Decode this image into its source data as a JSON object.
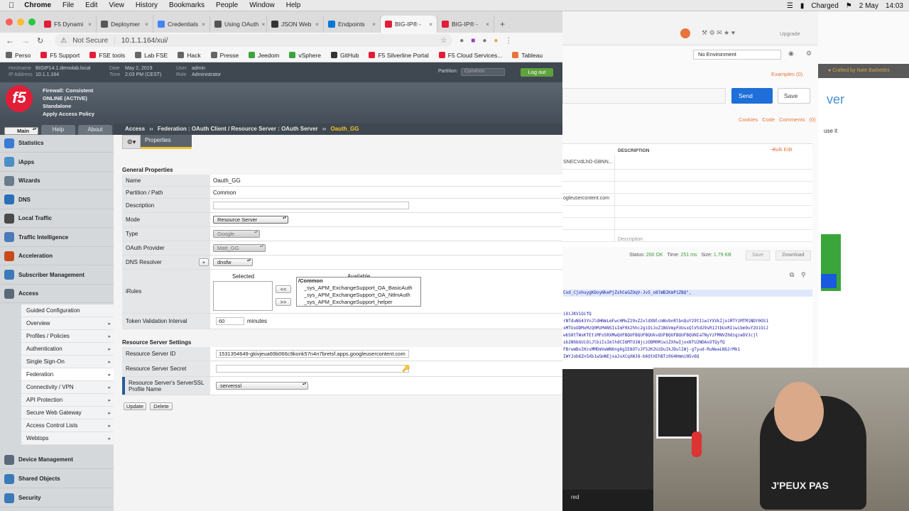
{
  "os_menubar": {
    "app": "Chrome",
    "menus": [
      "File",
      "Edit",
      "View",
      "History",
      "Bookmarks",
      "People",
      "Window",
      "Help"
    ],
    "battery": "Charged",
    "date": "2 May",
    "time": "14:03"
  },
  "browser": {
    "tabs": [
      {
        "label": "F5 Dynami",
        "color": "#e21d38"
      },
      {
        "label": "Deploymer",
        "color": "#555555"
      },
      {
        "label": "Credentials",
        "color": "#4285f4"
      },
      {
        "label": "Using OAuth",
        "color": "#555555"
      },
      {
        "label": "JSON Web",
        "color": "#333333"
      },
      {
        "label": "Endpoints",
        "color": "#0078d4"
      },
      {
        "label": "BIG-IP® -",
        "color": "#e21d38",
        "active": true
      },
      {
        "label": "BIG-IP® -",
        "color": "#e21d38"
      }
    ],
    "security": "Not Secure",
    "url": "10.1.1.164/xui/",
    "bookmarks": [
      "Perso",
      "F5 Support",
      "FSE tools",
      "Lab FSE",
      "Hack",
      "Presse",
      "Jeedom",
      "vSphere",
      "GitHub",
      "F5 Silverline Portal",
      "F5 Cloud Services...",
      "Tableau"
    ]
  },
  "f5": {
    "header": {
      "hostname_label": "Hostname",
      "hostname": "BIGIP14.1.demolab.local",
      "ip_label": "IP Address",
      "ip": "10.1.1.164",
      "date_label": "Date",
      "date": "May 2, 2019",
      "time_label": "Time",
      "time": "2:03 PM (CEST)",
      "user_label": "User",
      "user": "admin",
      "role_label": "Role",
      "role": "Administrator",
      "partition_label": "Partition:",
      "partition": "Common",
      "logout": "Log out"
    },
    "logo": "f5",
    "status_lines": [
      "Firewall: Consistent",
      "ONLINE (ACTIVE)",
      "Standalone",
      "Apply Access Policy"
    ],
    "nav_tabs": [
      "Main",
      "Help",
      "About"
    ],
    "breadcrumb": {
      "root": "Access",
      "sep": "››",
      "mid": "Federation : OAuth Client / Resource Server : OAuth Server",
      "sep2": "››",
      "current": "Oauth_GG"
    },
    "sidebar": [
      {
        "label": "Statistics",
        "color": "#3a7bd5"
      },
      {
        "label": "iApps",
        "color": "#4a90c8"
      },
      {
        "label": "Wizards",
        "color": "#6a7b8c"
      },
      {
        "label": "DNS",
        "color": "#2a6fb8"
      },
      {
        "label": "Local Traffic",
        "color": "#4a4a4a"
      },
      {
        "label": "Traffic Intelligence",
        "color": "#4a7ab8"
      },
      {
        "label": "Acceleration",
        "color": "#c84a1a"
      },
      {
        "label": "Subscriber Management",
        "color": "#3a7ab8"
      },
      {
        "label": "Access",
        "color": "#5a6a7a"
      }
    ],
    "access_sub": [
      "Guided Configuration",
      "Overview",
      "Profiles / Policies",
      "Authentication",
      "Single Sign-On",
      "Federation",
      "Connectivity / VPN",
      "API Protection",
      "Secure Web Gateway",
      "Access Control Lists",
      "Webtops"
    ],
    "sidebar_bottom": [
      {
        "label": "Device Management",
        "color": "#5a6a7a"
      },
      {
        "label": "Shared Objects",
        "color": "#3a7ab8"
      },
      {
        "label": "Security",
        "color": "#3a7ab8"
      }
    ],
    "properties_tab": "Properties",
    "general_title": "General Properties",
    "fields": {
      "name_label": "Name",
      "name": "Oauth_GG",
      "partition_label": "Partition / Path",
      "partition": "Common",
      "description_label": "Description",
      "description": "",
      "mode_label": "Mode",
      "mode": "Resource Server",
      "type_label": "Type",
      "type": "Google",
      "provider_label": "OAuth Provider",
      "provider": "Matt_GG",
      "dns_label": "DNS Resolver",
      "dns_plus": "+",
      "dns": "dnsfw",
      "irules_label": "iRules",
      "selected_label": "Selected",
      "available_label": "Available",
      "move_left": "<<",
      "move_right": ">>",
      "available_items": [
        "/Common",
        "_sys_APM_ExchangeSupport_OA_BasicAuth",
        "_sys_APM_ExchangeSupport_OA_NtlmAuth",
        "_sys_APM_ExchangeSupport_helper"
      ],
      "token_label": "Token Validation Interval",
      "token": "60",
      "token_unit": "minutes"
    },
    "rs_title": "Resource Server Settings",
    "rs": {
      "id_label": "Resource Server ID",
      "id": "1531354649-gkivjeua69b066c9konk57n4n7bretsf.apps.googleusercontent.com",
      "secret_label": "Resource Server Secret",
      "secret": "",
      "ssl_label": "Resource Server's ServerSSL Profile Name",
      "ssl": "serverssl"
    },
    "buttons": {
      "update": "Update",
      "delete": "Delete"
    }
  },
  "postman": {
    "upgrade": "Upgrade",
    "environment": "No Environment",
    "examples": "Examples (0)",
    "send": "Send",
    "save": "Save",
    "links": "Cookies Code Comments (0)",
    "description_header": "DESCRIPTION",
    "bulk_edit": "Bulk Edit",
    "rows": [
      "SNECVdLhO-GBNN...",
      "",
      "",
      "ogleusercontent.com",
      "",
      "",
      ""
    ],
    "description_placeholder": "Description",
    "status_label": "Status:",
    "status": "200 OK",
    "time_label": "Time:",
    "time": "251 ms",
    "size_label": "Size:",
    "size": "1.79 KB",
    "save2": "Save",
    "download": "Download",
    "body_lines": [
      "Cxd_CjohuygKDoyNkePjZshCeGZOqV-Jv5_o8lWBIKmP1ZBQ\",",
      "",
      "",
      "iOiJKV1QifQ",
      "rNTduNG43YnJldHNmLmFwcHMuZ29vZ2xldXNlcmNvbnRlbnQuY29tIiwiYXVkIjoiMTYzMTM1NDY0OS1",
      "xMTUxODMxMzQ0MzM4NSIsImF0X2hhc2giOiJoZ1NGVmpFUUsxQlV5d29sR1JtbUxRIiwibm9uY2UiOiJ",
      "wbS8tTWxKTEtiMFo5RXMwQUFBQUFBQUFBQUkvQUFBQUFBQUFBQUNIaTNyYzFMNVZ0dzgzeDVJcjl",
      "sb2NhbGUiOiJlbiIsImlhdCI6MTU1NjczODM0MiwiZXhwIjoxNTU2NDAxOTQyfQ",
      "FBrwmBsIHzsMMDmVwWN6ng6gIE8OTvJF52K2UzDuIkJDulIWj-gTyud-RuNeaLNG2rMk1",
      "IWYJob8Zn5Xb1wSmNEjxaJsXCqXWJ8-b6QtXEhBTz0U4HmmiN5v6Q"
    ],
    "side_title": "Crafted by Nate Barbettini",
    "side_fragment": "ver",
    "side_fragment2": "use it"
  },
  "terminal": {
    "text": "red"
  },
  "webcam": {
    "shirt": "J'PEUX PAS"
  }
}
